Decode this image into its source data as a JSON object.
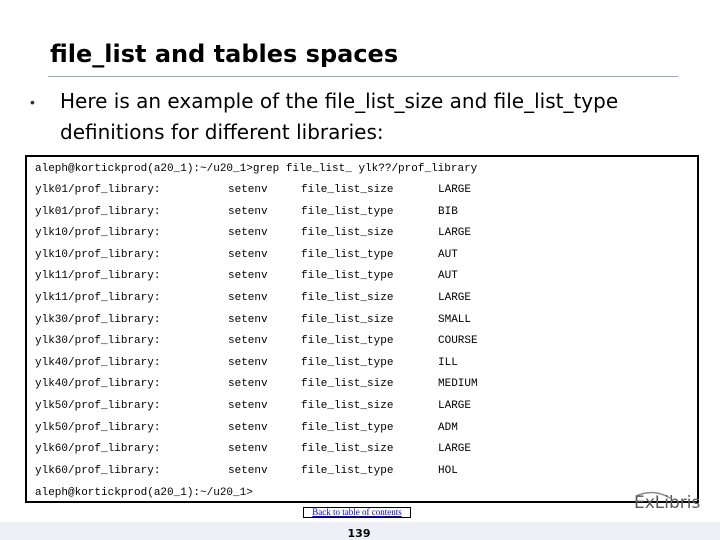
{
  "slide": {
    "title": "file_list and tables spaces",
    "bullet_text": "Here is an example of the file_list_size and file_list_type definitions for different libraries:",
    "bullet_symbol": "•"
  },
  "terminal": {
    "command_line": "aleph@kortickprod(a20_1):~/u20_1>grep file_list_ ylk??/prof_library",
    "rows": [
      {
        "library": "ylk01/prof_library:",
        "command": "setenv",
        "variable": "file_list_size",
        "value": "LARGE"
      },
      {
        "library": "ylk01/prof_library:",
        "command": "setenv",
        "variable": "file_list_type",
        "value": "BIB"
      },
      {
        "library": "ylk10/prof_library:",
        "command": "setenv",
        "variable": "file_list_size",
        "value": "LARGE"
      },
      {
        "library": "ylk10/prof_library:",
        "command": "setenv",
        "variable": "file_list_type",
        "value": "AUT"
      },
      {
        "library": "ylk11/prof_library:",
        "command": "setenv",
        "variable": "file_list_type",
        "value": "AUT"
      },
      {
        "library": "ylk11/prof_library:",
        "command": "setenv",
        "variable": "file_list_size",
        "value": "LARGE"
      },
      {
        "library": "ylk30/prof_library:",
        "command": "setenv",
        "variable": "file_list_size",
        "value": "SMALL"
      },
      {
        "library": "ylk30/prof_library:",
        "command": "setenv",
        "variable": "file_list_type",
        "value": "COURSE"
      },
      {
        "library": "ylk40/prof_library:",
        "command": "setenv",
        "variable": "file_list_type",
        "value": "ILL"
      },
      {
        "library": "ylk40/prof_library:",
        "command": "setenv",
        "variable": "file_list_size",
        "value": "MEDIUM"
      },
      {
        "library": "ylk50/prof_library:",
        "command": "setenv",
        "variable": "file_list_size",
        "value": "LARGE"
      },
      {
        "library": "ylk50/prof_library:",
        "command": "setenv",
        "variable": "file_list_type",
        "value": "ADM"
      },
      {
        "library": "ylk60/prof_library:",
        "command": "setenv",
        "variable": "file_list_size",
        "value": "LARGE"
      },
      {
        "library": "ylk60/prof_library:",
        "command": "setenv",
        "variable": "file_list_type",
        "value": "HOL"
      }
    ],
    "prompt_line": "aleph@kortickprod(a20_1):~/u20_1>"
  },
  "footer": {
    "link_text": "Back to table of contents",
    "page_number": "139",
    "logo_text": "ExLibris",
    "logo_icon": "exlibris-logo-icon"
  },
  "colors": {
    "title_rule": "#9aa7c4",
    "link": "#0000ee",
    "footer_band": "#eef0f6",
    "logo_text": "#58595b",
    "logo_swoosh": "#8a8c8e"
  }
}
